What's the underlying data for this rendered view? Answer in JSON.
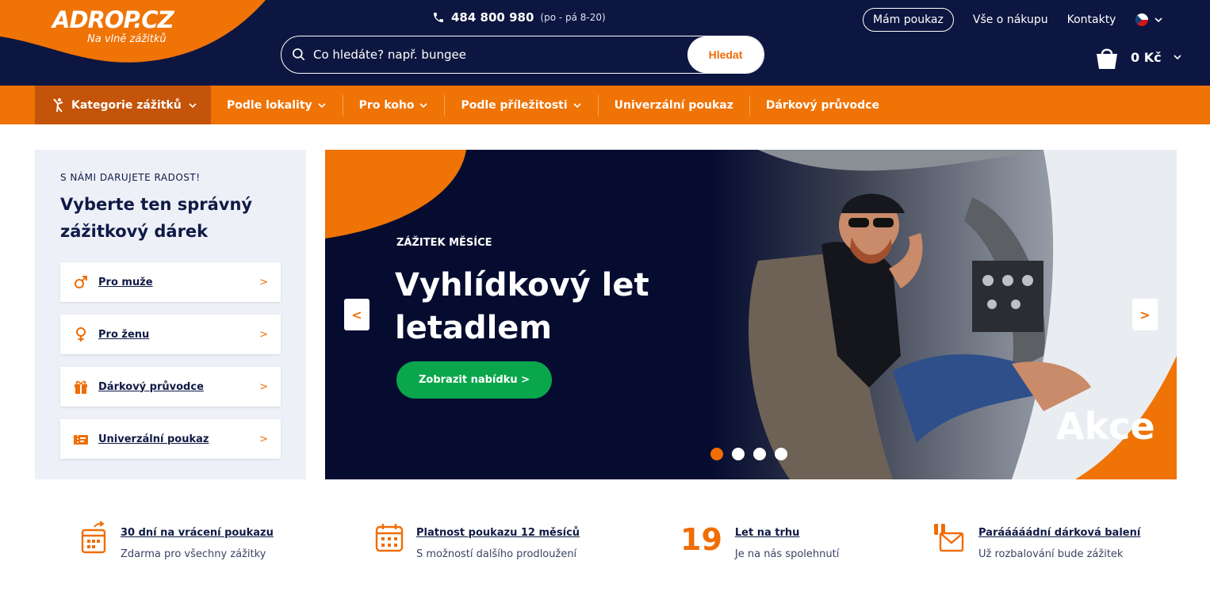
{
  "header": {
    "logo": "ADROP.CZ",
    "tagline": "Na vlně zážitků",
    "phone_number": "484 800 980",
    "phone_hours": "(po - pá 8-20)",
    "search_placeholder": "Co hledáte? např. bungee",
    "search_button": "Hledat",
    "voucher_button": "Mám poukaz",
    "about_link": "Vše o nákupu",
    "contacts_link": "Kontakty",
    "cart_total": "0 Kč",
    "icons": [
      "phone-icon",
      "search-icon",
      "flag-cz-icon",
      "cart-icon"
    ]
  },
  "nav": {
    "category_label": "Kategorie zážitků",
    "items": [
      {
        "label": "Podle lokality"
      },
      {
        "label": "Pro koho"
      },
      {
        "label": "Podle příležitosti"
      },
      {
        "label": "Univerzální poukaz"
      },
      {
        "label": "Dárkový průvodce"
      }
    ]
  },
  "panel": {
    "kicker": "S NÁMI DARUJETE RADOST!",
    "title": "Vyberte ten správný zážitkový dárek",
    "items": [
      {
        "label": "Pro muže",
        "icon": "male-symbol-icon"
      },
      {
        "label": "Pro ženu",
        "icon": "female-symbol-icon"
      },
      {
        "label": "Dárkový průvodce",
        "icon": "gift-icon"
      },
      {
        "label": "Univerzální poukaz",
        "icon": "voucher-icon"
      }
    ]
  },
  "hero": {
    "kicker": "ZÁŽITEK MĚSÍCE",
    "title": "Vyhlídkový let letadlem",
    "cta": "Zobrazit nabídku >",
    "badge": "Akce",
    "slides": 4,
    "active_slide": 1
  },
  "features": [
    {
      "title": "30 dní na vrácení poukazu",
      "subtitle": "Zdarma pro všechny zážitky",
      "icon": "calendar-return-icon"
    },
    {
      "title": "Platnost poukazu 12 měsíců",
      "subtitle": "S možností dalšího prodloužení",
      "icon": "calendar-icon"
    },
    {
      "big": "19",
      "title": "Let na trhu",
      "subtitle": "Je na nás spolehnutí"
    },
    {
      "title": "Parááááádní dárková balení",
      "subtitle": "Už rozbalování bude zážitek",
      "icon": "gift-box-icon"
    }
  ],
  "colors": {
    "navy": "#0d1640",
    "orange": "#f07306",
    "green": "#0aa64b"
  }
}
